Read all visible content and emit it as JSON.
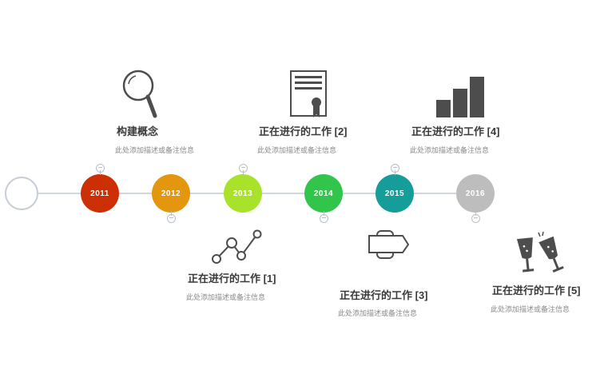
{
  "timeline": {
    "nodes": [
      {
        "year": "2011",
        "color": "#cc2f04"
      },
      {
        "year": "2012",
        "color": "#e3960e"
      },
      {
        "year": "2013",
        "color": "#a9e22a"
      },
      {
        "year": "2014",
        "color": "#31c64b"
      },
      {
        "year": "2015",
        "color": "#159d9a"
      },
      {
        "year": "2016",
        "color": "#bdbdbd"
      }
    ],
    "events": [
      {
        "title": "构建概念",
        "desc": "此处添加描述或备注信息",
        "icon": "magnifier-icon"
      },
      {
        "title": "正在进行的工作 [1]",
        "desc": "此处添加描述或备注信息",
        "icon": "line-chart-icon"
      },
      {
        "title": "正在进行的工作 [2]",
        "desc": "此处添加描述或备注信息",
        "icon": "certificate-icon"
      },
      {
        "title": "正在进行的工作 [3]",
        "desc": "此处添加描述或备注信息",
        "icon": "signpost-icon"
      },
      {
        "title": "正在进行的工作 [4]",
        "desc": "此处添加描述或备注信息",
        "icon": "bar-chart-icon"
      },
      {
        "title": "正在进行的工作 [5]",
        "desc": "此处添加描述或备注信息",
        "icon": "champagne-icon"
      }
    ],
    "colors": {
      "axis": "#cfd6df",
      "icon": "#4d4d4d",
      "title": "#3a3a3a",
      "desc": "#8a8a8a"
    }
  }
}
